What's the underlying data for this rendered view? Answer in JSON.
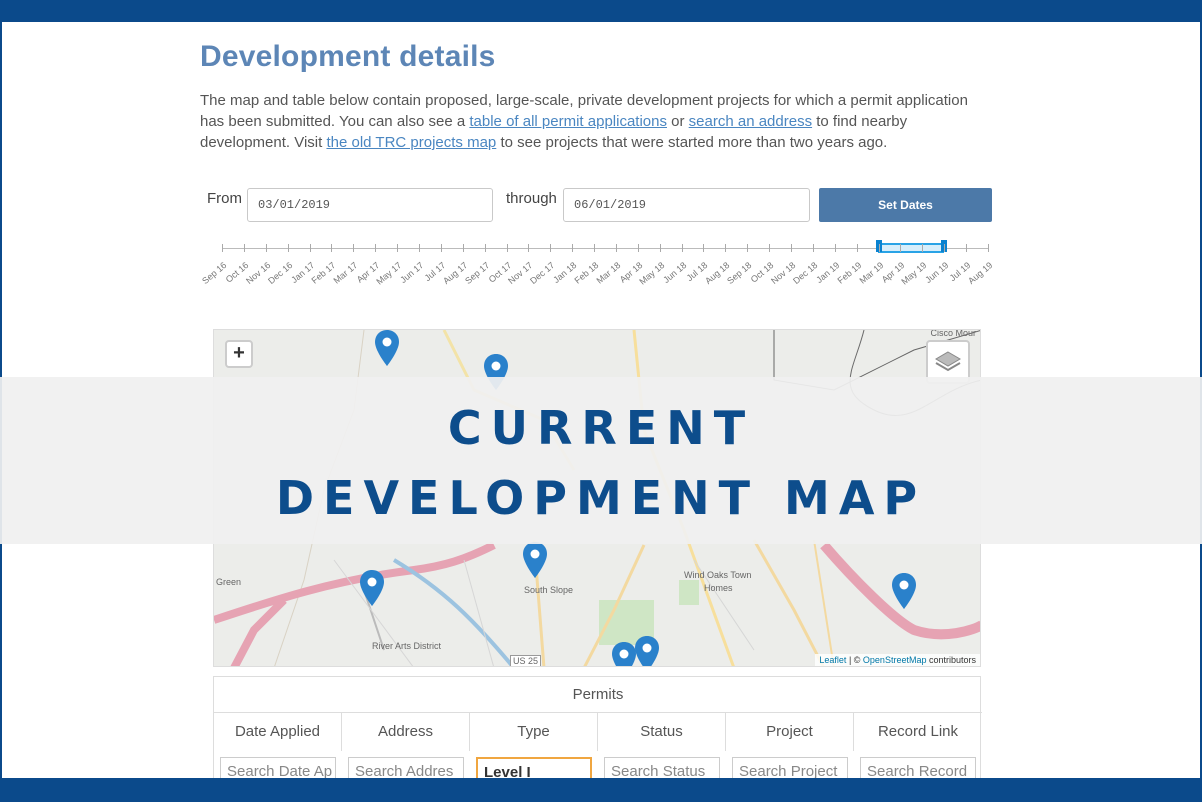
{
  "page": {
    "title": "Development details",
    "intro": {
      "part1": "The map and table below contain proposed, large-scale, private development projects for which a permit application has been submitted. You can also see a ",
      "link1": "table of all permit applications",
      "part2": " or ",
      "link2": "search an address",
      "part3": " to find nearby development. Visit ",
      "link3": "the old TRC projects map",
      "part4": " to see projects that were started more than two years ago."
    }
  },
  "date_filter": {
    "from_label": "From",
    "from_value": "03/01/2019",
    "through_label": "through",
    "through_value": "06/01/2019",
    "set_button": "Set Dates"
  },
  "timeline": {
    "labels": [
      "Sep 16",
      "Oct 16",
      "Nov 16",
      "Dec 16",
      "Jan 17",
      "Feb 17",
      "Mar 17",
      "Apr 17",
      "May 17",
      "Jun 17",
      "Jul 17",
      "Aug 17",
      "Sep 17",
      "Oct 17",
      "Nov 17",
      "Dec 17",
      "Jan 18",
      "Feb 18",
      "Mar 18",
      "Apr 18",
      "May 18",
      "Jun 18",
      "Jul 18",
      "Aug 18",
      "Sep 18",
      "Oct 18",
      "Nov 18",
      "Dec 18",
      "Jan 19",
      "Feb 19",
      "Mar 19",
      "Apr 19",
      "May 19",
      "Jun 19",
      "Jul 19",
      "Aug 19"
    ],
    "selected_range": [
      "Mar 19",
      "Jun 19"
    ]
  },
  "map": {
    "zoom_in": "+",
    "labels": {
      "cisco": "Cisco Mour",
      "green": "Green",
      "river_arts": "River Arts District",
      "south_slope": "South Slope",
      "wind_oaks": "Wind Oaks Town",
      "homes": "Homes",
      "us25": "US 25"
    },
    "attribution": {
      "leaflet": "Leaflet",
      "sep": " | © ",
      "osm": "OpenStreetMap",
      "contrib": " contributors"
    },
    "marker_color": "#2a81cb",
    "icons": [
      "layers-icon",
      "map-marker-icon"
    ]
  },
  "banner": {
    "line1": "CURRENT",
    "line2": "DEVELOPMENT MAP",
    "color": "#0d4d8c"
  },
  "table": {
    "caption": "Permits",
    "columns": [
      "Date Applied",
      "Address",
      "Type",
      "Status",
      "Project",
      "Record Link"
    ],
    "filters": [
      "Search Date Ap",
      "Search Addres",
      "Level I",
      "Search Status",
      "Search Project",
      "Search Record"
    ]
  },
  "colors": {
    "frame": "#0b4a8b",
    "title": "#5d86b6",
    "button": "#4c79a8"
  }
}
